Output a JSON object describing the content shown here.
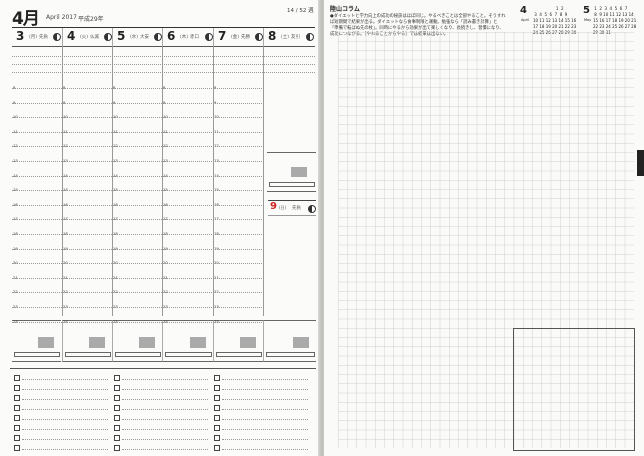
{
  "left_page": {
    "month": "4月",
    "month_english": "April 2017",
    "era_year": "平成29年",
    "week_number": "14 / 52 週",
    "days": [
      {
        "num": "3",
        "dow": "(月)",
        "rokuyo": "先負"
      },
      {
        "num": "4",
        "dow": "(火)",
        "rokuyo": "仏滅"
      },
      {
        "num": "5",
        "dow": "(水)",
        "rokuyo": "大安"
      },
      {
        "num": "6",
        "dow": "(木)",
        "rokuyo": "赤口"
      },
      {
        "num": "7",
        "dow": "(金)",
        "rokuyo": "先勝"
      },
      {
        "num": "8",
        "dow": "(土)",
        "rokuyo": "友引"
      }
    ],
    "sunday": {
      "num": "9",
      "dow": "(日)",
      "rokuyo": "先負"
    },
    "hours": [
      "8",
      "9",
      "10",
      "11",
      "12",
      "13",
      "14",
      "15",
      "16",
      "17",
      "18",
      "19",
      "20",
      "21",
      "22",
      "23",
      "24"
    ]
  },
  "right_page": {
    "column_title": "陸山コラム",
    "column_text": "●ダイエットと学力向上の成功の秘訣はほぼ同じ。やるべきことは全部やること。そうすれば短期間で結果が出る。ダイエットなら食事制限と運動。勉強なら「読み書き計算」と「準備で転ばぬ先の杖」。同時にやるから効果が出て楽しくなり、長続きし、習慣になり、成功につながる。［やれることからやる］では結果は出ない。",
    "calendars": [
      {
        "month": "4",
        "label": "April",
        "rows": [
          "                  1  2",
          " 3  4  5  6  7  8  9",
          "10 11 12 13 14 15 16",
          "17 18 19 20 21 22 23",
          "24 25 26 27 28 29 30"
        ]
      },
      {
        "month": "5",
        "label": "May",
        "rows": [
          " 1  2  3  4  5  6  7",
          " 8  9 10 11 12 13 14",
          "15 16 17 18 19 20 21",
          "22 23 24 25 26 27 28",
          "29 30 31"
        ]
      }
    ]
  },
  "colors": {
    "page": "#fbfbf9",
    "grid": "#cfcfcb",
    "holiday": "#cc2222",
    "tab": "#222222"
  }
}
